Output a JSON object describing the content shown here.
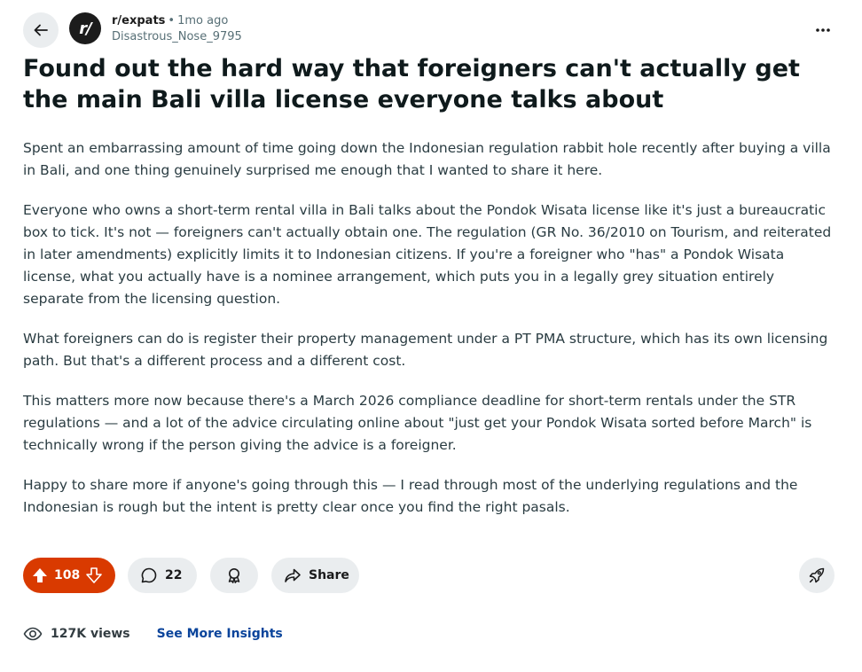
{
  "post": {
    "subreddit": "r/expats",
    "separator": "•",
    "time_ago": "1mo ago",
    "author": "Disastrous_Nose_9795",
    "avatar_text": "r/",
    "title": "Found out the hard way that foreigners can't actually get the main Bali villa license everyone talks about",
    "paragraphs": [
      "Spent an embarrassing amount of time going down the Indonesian regulation rabbit hole recently after buying a villa in Bali, and one thing genuinely surprised me enough that I wanted to share it here.",
      "Everyone who owns a short-term rental villa in Bali talks about the Pondok Wisata license like it's just a bureaucratic box to tick. It's not — foreigners can't actually obtain one. The regulation (GR No. 36/2010 on Tourism, and reiterated in later amendments) explicitly limits it to Indonesian citizens. If you're a foreigner who \"has\" a Pondok Wisata license, what you actually have is a nominee arrangement, which puts you in a legally grey situation entirely separate from the licensing question.",
      "What foreigners can do is register their property management under a PT PMA structure, which has its own licensing path. But that's a different process and a different cost.",
      "This matters more now because there's a March 2026 compliance deadline for short-term rentals under the STR regulations — and a lot of the advice circulating online about \"just get your Pondok Wisata sorted before March\" is technically wrong if the person giving the advice is a foreigner.",
      "Happy to share more if anyone's going through this — I read through most of the underlying regulations and the Indonesian is rough but the intent is pretty clear once you find the right pasals."
    ]
  },
  "actions": {
    "upvotes": "108",
    "comments": "22",
    "share_label": "Share"
  },
  "insights": {
    "views": "127K views",
    "see_more": "See More Insights"
  },
  "icons": {
    "back": "arrow-left-icon",
    "more": "more-horizontal-icon",
    "upvote": "upvote-icon",
    "downvote": "downvote-icon",
    "comment": "comment-icon",
    "award": "award-icon",
    "share": "share-icon",
    "boost": "rocket-icon",
    "views": "eye-icon"
  },
  "colors": {
    "vote_active": "#d93a00",
    "pill_bg": "#eaedef",
    "link": "#0a449b"
  }
}
